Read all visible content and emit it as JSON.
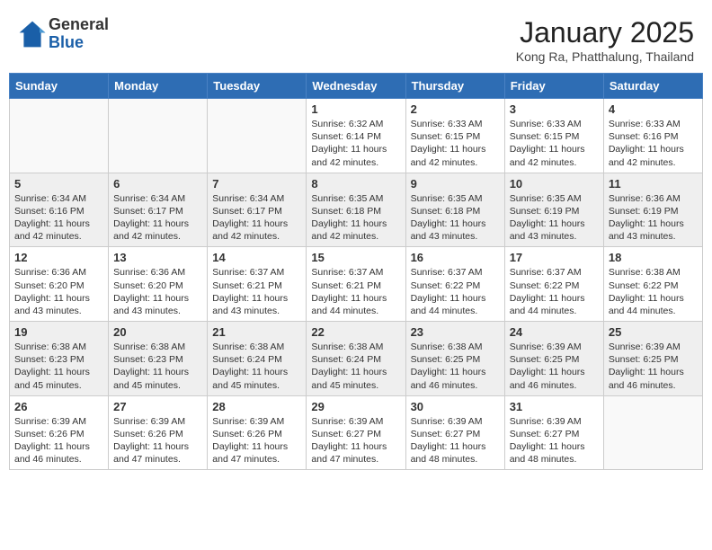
{
  "header": {
    "logo_general": "General",
    "logo_blue": "Blue",
    "month": "January 2025",
    "location": "Kong Ra, Phatthalung, Thailand"
  },
  "weekdays": [
    "Sunday",
    "Monday",
    "Tuesday",
    "Wednesday",
    "Thursday",
    "Friday",
    "Saturday"
  ],
  "weeks": [
    [
      {
        "day": "",
        "info": ""
      },
      {
        "day": "",
        "info": ""
      },
      {
        "day": "",
        "info": ""
      },
      {
        "day": "1",
        "info": "Sunrise: 6:32 AM\nSunset: 6:14 PM\nDaylight: 11 hours and 42 minutes."
      },
      {
        "day": "2",
        "info": "Sunrise: 6:33 AM\nSunset: 6:15 PM\nDaylight: 11 hours and 42 minutes."
      },
      {
        "day": "3",
        "info": "Sunrise: 6:33 AM\nSunset: 6:15 PM\nDaylight: 11 hours and 42 minutes."
      },
      {
        "day": "4",
        "info": "Sunrise: 6:33 AM\nSunset: 6:16 PM\nDaylight: 11 hours and 42 minutes."
      }
    ],
    [
      {
        "day": "5",
        "info": "Sunrise: 6:34 AM\nSunset: 6:16 PM\nDaylight: 11 hours and 42 minutes."
      },
      {
        "day": "6",
        "info": "Sunrise: 6:34 AM\nSunset: 6:17 PM\nDaylight: 11 hours and 42 minutes."
      },
      {
        "day": "7",
        "info": "Sunrise: 6:34 AM\nSunset: 6:17 PM\nDaylight: 11 hours and 42 minutes."
      },
      {
        "day": "8",
        "info": "Sunrise: 6:35 AM\nSunset: 6:18 PM\nDaylight: 11 hours and 42 minutes."
      },
      {
        "day": "9",
        "info": "Sunrise: 6:35 AM\nSunset: 6:18 PM\nDaylight: 11 hours and 43 minutes."
      },
      {
        "day": "10",
        "info": "Sunrise: 6:35 AM\nSunset: 6:19 PM\nDaylight: 11 hours and 43 minutes."
      },
      {
        "day": "11",
        "info": "Sunrise: 6:36 AM\nSunset: 6:19 PM\nDaylight: 11 hours and 43 minutes."
      }
    ],
    [
      {
        "day": "12",
        "info": "Sunrise: 6:36 AM\nSunset: 6:20 PM\nDaylight: 11 hours and 43 minutes."
      },
      {
        "day": "13",
        "info": "Sunrise: 6:36 AM\nSunset: 6:20 PM\nDaylight: 11 hours and 43 minutes."
      },
      {
        "day": "14",
        "info": "Sunrise: 6:37 AM\nSunset: 6:21 PM\nDaylight: 11 hours and 43 minutes."
      },
      {
        "day": "15",
        "info": "Sunrise: 6:37 AM\nSunset: 6:21 PM\nDaylight: 11 hours and 44 minutes."
      },
      {
        "day": "16",
        "info": "Sunrise: 6:37 AM\nSunset: 6:22 PM\nDaylight: 11 hours and 44 minutes."
      },
      {
        "day": "17",
        "info": "Sunrise: 6:37 AM\nSunset: 6:22 PM\nDaylight: 11 hours and 44 minutes."
      },
      {
        "day": "18",
        "info": "Sunrise: 6:38 AM\nSunset: 6:22 PM\nDaylight: 11 hours and 44 minutes."
      }
    ],
    [
      {
        "day": "19",
        "info": "Sunrise: 6:38 AM\nSunset: 6:23 PM\nDaylight: 11 hours and 45 minutes."
      },
      {
        "day": "20",
        "info": "Sunrise: 6:38 AM\nSunset: 6:23 PM\nDaylight: 11 hours and 45 minutes."
      },
      {
        "day": "21",
        "info": "Sunrise: 6:38 AM\nSunset: 6:24 PM\nDaylight: 11 hours and 45 minutes."
      },
      {
        "day": "22",
        "info": "Sunrise: 6:38 AM\nSunset: 6:24 PM\nDaylight: 11 hours and 45 minutes."
      },
      {
        "day": "23",
        "info": "Sunrise: 6:38 AM\nSunset: 6:25 PM\nDaylight: 11 hours and 46 minutes."
      },
      {
        "day": "24",
        "info": "Sunrise: 6:39 AM\nSunset: 6:25 PM\nDaylight: 11 hours and 46 minutes."
      },
      {
        "day": "25",
        "info": "Sunrise: 6:39 AM\nSunset: 6:25 PM\nDaylight: 11 hours and 46 minutes."
      }
    ],
    [
      {
        "day": "26",
        "info": "Sunrise: 6:39 AM\nSunset: 6:26 PM\nDaylight: 11 hours and 46 minutes."
      },
      {
        "day": "27",
        "info": "Sunrise: 6:39 AM\nSunset: 6:26 PM\nDaylight: 11 hours and 47 minutes."
      },
      {
        "day": "28",
        "info": "Sunrise: 6:39 AM\nSunset: 6:26 PM\nDaylight: 11 hours and 47 minutes."
      },
      {
        "day": "29",
        "info": "Sunrise: 6:39 AM\nSunset: 6:27 PM\nDaylight: 11 hours and 47 minutes."
      },
      {
        "day": "30",
        "info": "Sunrise: 6:39 AM\nSunset: 6:27 PM\nDaylight: 11 hours and 48 minutes."
      },
      {
        "day": "31",
        "info": "Sunrise: 6:39 AM\nSunset: 6:27 PM\nDaylight: 11 hours and 48 minutes."
      },
      {
        "day": "",
        "info": ""
      }
    ]
  ]
}
